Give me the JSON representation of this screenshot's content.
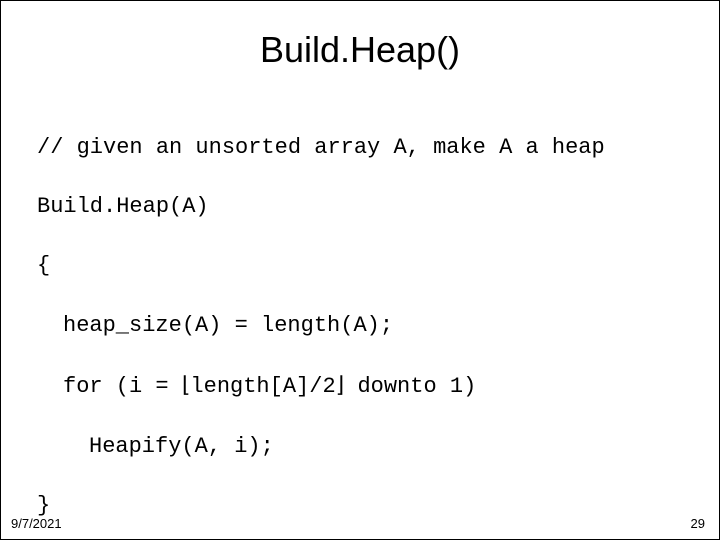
{
  "slide": {
    "title": "Build.Heap()",
    "code": {
      "line1": "// given an unsorted array A, make A a heap",
      "line2": "Build.Heap(A)",
      "line3": "{",
      "line4": "heap_size(A) = length(A);",
      "line5_pre": "for (i = ",
      "line5_floor_open": "⌊",
      "line5_mid": "length[A]/2",
      "line5_floor_close": "⌋",
      "line5_post": " downto 1)",
      "line6": "Heapify(A, i);",
      "line7": "}"
    },
    "footer": {
      "date": "9/7/2021",
      "page": "29"
    }
  }
}
